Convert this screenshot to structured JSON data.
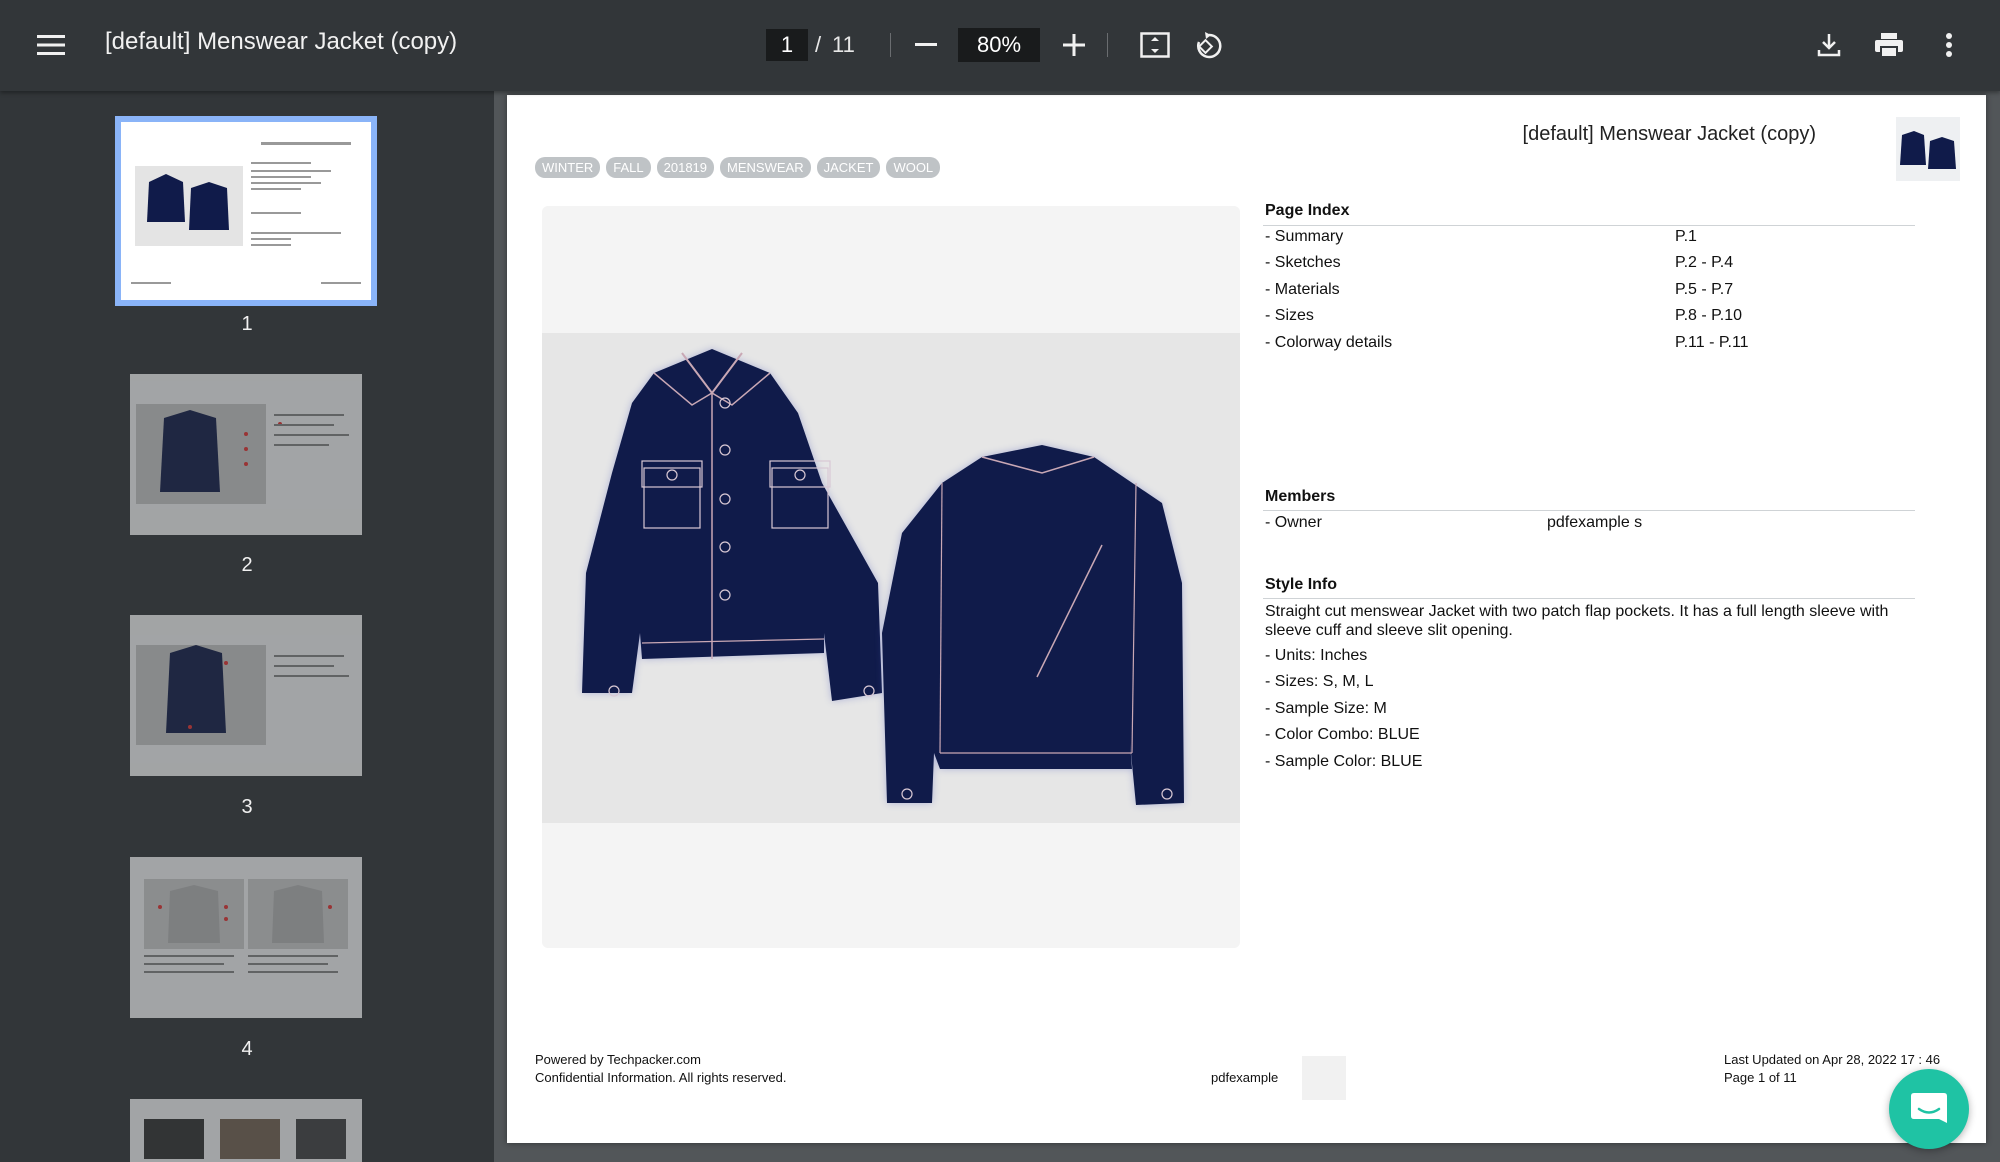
{
  "toolbar": {
    "title": "[default] Menswear Jacket (copy)",
    "page_current": "1",
    "page_sep": "/",
    "page_total": "11",
    "zoom": "80%"
  },
  "sidebar": {
    "thumbnails": [
      {
        "label": "1",
        "selected": true
      },
      {
        "label": "2",
        "selected": false
      },
      {
        "label": "3",
        "selected": false
      },
      {
        "label": "4",
        "selected": false
      }
    ]
  },
  "page": {
    "title": "[default] Menswear Jacket (copy)",
    "tags": [
      "WINTER",
      "FALL",
      "201819",
      "MENSWEAR",
      "JACKET",
      "WOOL"
    ],
    "page_index": {
      "heading": "Page Index",
      "rows": [
        {
          "label": "- Summary",
          "value": "P.1"
        },
        {
          "label": "- Sketches",
          "value": "P.2 - P.4"
        },
        {
          "label": "- Materials",
          "value": "P.5 - P.7"
        },
        {
          "label": "- Sizes",
          "value": "P.8 - P.10"
        },
        {
          "label": "- Colorway details",
          "value": "P.11 - P.11"
        }
      ]
    },
    "members": {
      "heading": "Members",
      "rows": [
        {
          "label": "- Owner",
          "value": "pdfexample s"
        }
      ]
    },
    "style_info": {
      "heading": "Style Info",
      "description": "Straight cut menswear Jacket with two patch flap pockets. It has a full length sleeve with sleeve cuff and sleeve slit opening.",
      "items": [
        "- Units: Inches",
        "- Sizes: S, M, L",
        "- Sample Size: M",
        "- Color Combo: BLUE",
        "- Sample Color: BLUE"
      ]
    },
    "footer": {
      "powered": "Powered by Techpacker.com",
      "confidential": "Confidential Information. All rights reserved.",
      "signature": "pdfexample",
      "updated": "Last Updated on Apr 28, 2022 17 : 46",
      "page_of": "Page 1 of 11"
    }
  },
  "colors": {
    "toolbar": "#323639",
    "garment": "#101b4a",
    "chat": "#1fc3a4",
    "selected": "#8ab4f8"
  }
}
